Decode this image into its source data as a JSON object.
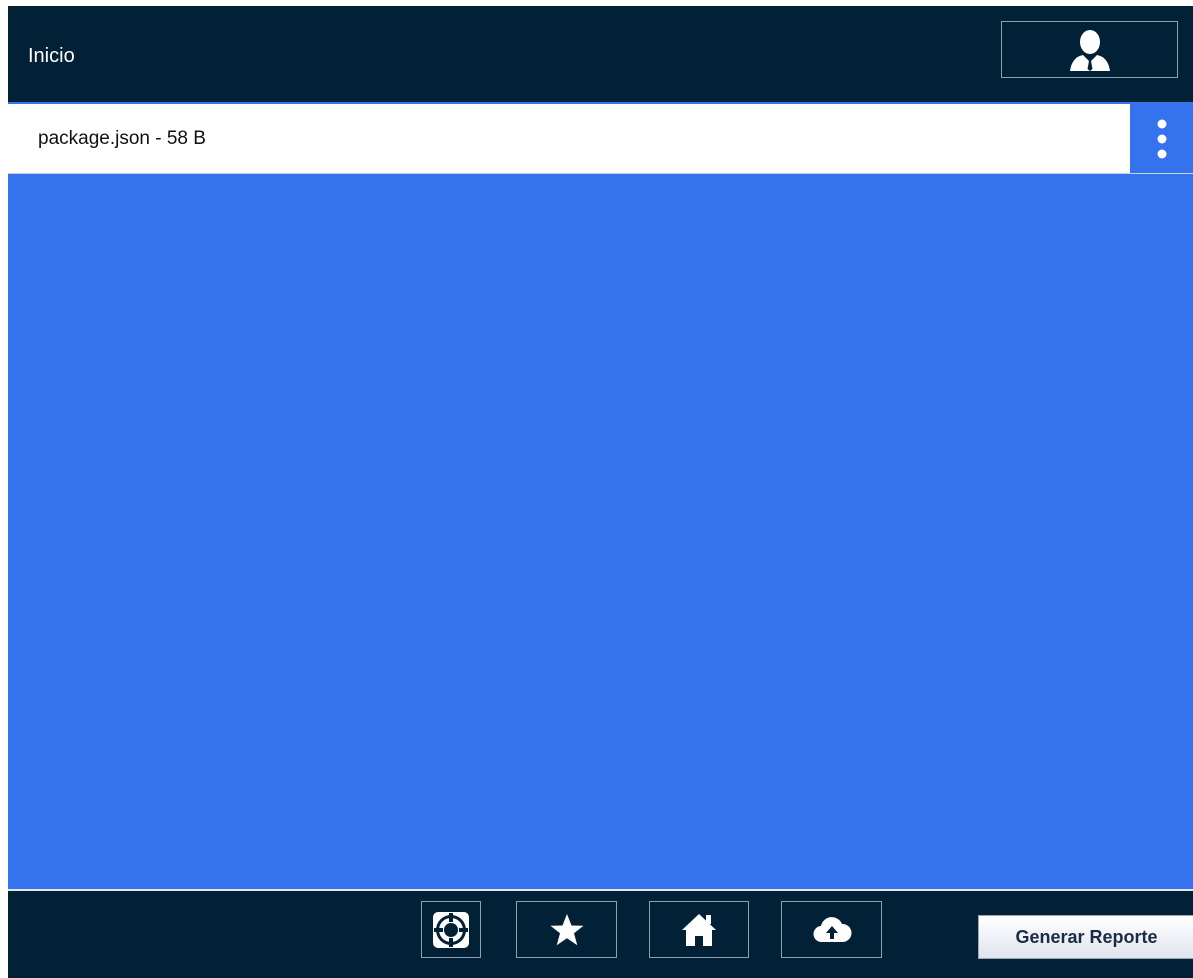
{
  "header": {
    "title": "Inicio",
    "profile_icon": "user-icon"
  },
  "file_list": {
    "items": [
      {
        "label": "package.json - 58 B",
        "menu_icon": "kebab-menu-icon"
      }
    ]
  },
  "footer": {
    "nav": [
      {
        "icon": "lifebuoy-icon"
      },
      {
        "icon": "star-icon"
      },
      {
        "icon": "home-icon"
      },
      {
        "icon": "cloud-upload-icon"
      }
    ],
    "report_label": "Generar Reporte"
  },
  "colors": {
    "header_bg": "#022036",
    "content_bg": "#3572ee",
    "row_bg": "#ffffff"
  }
}
